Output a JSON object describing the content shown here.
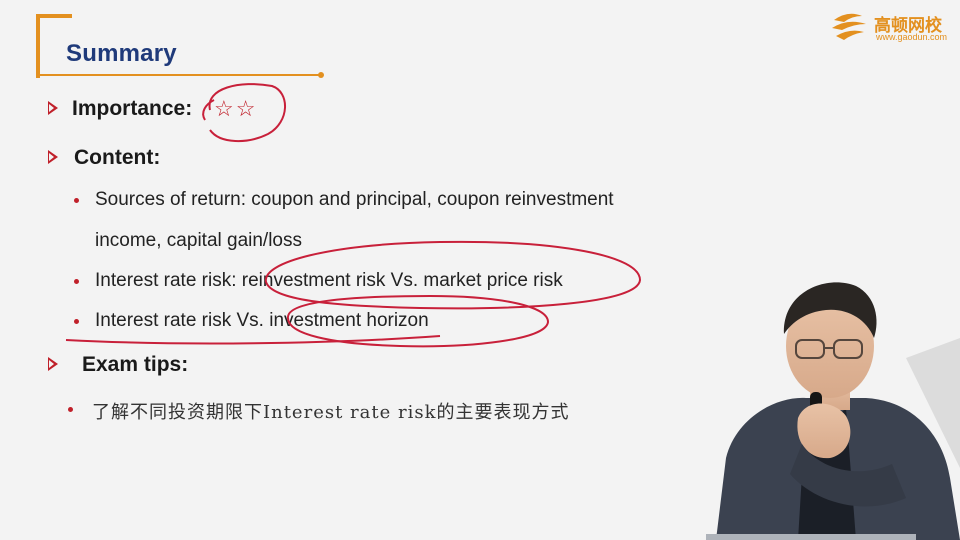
{
  "logo": {
    "name": "高顿网校",
    "url": "www.gaodun.com"
  },
  "slide": {
    "title": "Summary",
    "importance_label": "Importance:",
    "importance_stars": "☆☆",
    "content_label": "Content:",
    "content_items": [
      "Sources of return: coupon and principal, coupon reinvestment",
      "income, capital gain/loss",
      "Interest rate risk: reinvestment risk Vs. market price risk",
      "Interest rate risk Vs. investment horizon"
    ],
    "exam_tips_label": "Exam tips:",
    "exam_tips_items": [
      "了解不同投资期限下Interest rate risk的主要表现方式"
    ]
  },
  "colors": {
    "accent_orange": "#e3901f",
    "title_blue": "#1f3a7a",
    "bullet_red": "#c0202a",
    "annotation_red": "#c8203a"
  },
  "icons": {
    "logo": "gaodun-logo-icon",
    "section_bullet": "arrow-right-icon",
    "item_bullet": "dot-icon"
  }
}
